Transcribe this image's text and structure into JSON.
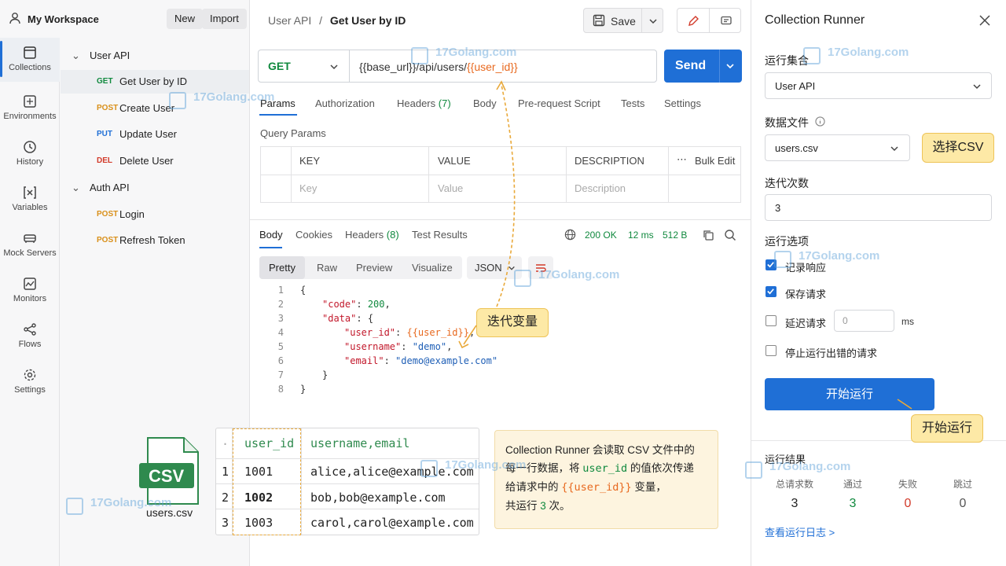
{
  "workspace": {
    "title": "My Workspace",
    "new_label": "New",
    "import_label": "Import"
  },
  "rail": [
    {
      "label": "Collections",
      "icon": "collections-icon"
    },
    {
      "label": "Environments",
      "icon": "environments-icon"
    },
    {
      "label": "History",
      "icon": "history-icon"
    },
    {
      "label": "Variables",
      "icon": "variables-icon"
    },
    {
      "label": "Mock Servers",
      "icon": "mock-servers-icon"
    },
    {
      "label": "Monitors",
      "icon": "monitors-icon"
    },
    {
      "label": "Flows",
      "icon": "flows-icon"
    },
    {
      "label": "Settings",
      "icon": "settings-icon"
    }
  ],
  "tree": {
    "folder1": "User API",
    "folder2": "Auth API",
    "requests": [
      {
        "method": "GET",
        "name": "Get User by ID"
      },
      {
        "method": "POST",
        "name": "Create User"
      },
      {
        "method": "PUT",
        "name": "Update User"
      },
      {
        "method": "DEL",
        "name": "Delete User"
      },
      {
        "method": "POST",
        "name": "Login"
      },
      {
        "method": "POST",
        "name": "Refresh Token"
      }
    ]
  },
  "breadcrumb": {
    "parent": "User API",
    "sep": "/",
    "current": "Get User by ID"
  },
  "save_label": "Save",
  "request": {
    "method": "GET",
    "url_prefix": "{{base_url}}/api/users/",
    "url_var": "{{user_id}}",
    "send_label": "Send",
    "tabs": [
      "Params",
      "Authorization",
      "Headers",
      "Body",
      "Pre-request Script",
      "Tests",
      "Settings"
    ],
    "headers_count": "(7)",
    "query_params_title": "Query Params",
    "columns": [
      "KEY",
      "VALUE",
      "DESCRIPTION"
    ],
    "bulk_edit": "Bulk Edit",
    "placeholders": [
      "Key",
      "Value",
      "Description"
    ]
  },
  "response": {
    "tabs": [
      "Body",
      "Cookies",
      "Headers",
      "Test Results"
    ],
    "headers_count": "(8)",
    "status": "200 OK",
    "time": "12 ms",
    "size": "512 B",
    "view_tabs": [
      "Pretty",
      "Raw",
      "Preview",
      "Visualize"
    ],
    "format": "JSON",
    "code_lines": [
      "1",
      "2",
      "3",
      "4",
      "5",
      "6",
      "7",
      "8"
    ],
    "code": {
      "open": "{",
      "code_key": "\"code\"",
      "code_val": "200",
      "data_key": "\"data\"",
      "data_open": "{",
      "uid_key": "\"user_id\"",
      "uid_val": "{{user_id}}",
      "uname_key": "\"username\"",
      "uname_val": "\"demo\"",
      "email_key": "\"email\"",
      "email_val": "\"demo@example.com\"",
      "inner_close": "}",
      "close": "}"
    }
  },
  "runner": {
    "title": "Collection Runner",
    "collection_label": "运行集合",
    "collection_value": "User API",
    "datafile_label": "数据文件",
    "datafile_value": "users.csv",
    "iterations_label": "迭代次数",
    "iterations_value": "3",
    "options_label": "运行选项",
    "options": [
      "记录响应",
      "保存请求",
      "延迟请求",
      "停止运行出错的请求"
    ],
    "delay_placeholder": "0",
    "delay_unit": "ms",
    "run_label": "开始运行",
    "results_label": "运行结果",
    "results_headers": [
      "总请求数",
      "通过",
      "失败",
      "跳过"
    ],
    "results_values": [
      "3",
      "3",
      "0",
      "0"
    ],
    "log_link": "查看运行日志 >",
    "colors": {
      "pass": "#10893e",
      "fail": "#d23a2a",
      "accent": "#1f6fd6"
    }
  },
  "callouts": {
    "csv": "选择CSV",
    "var": "迭代变量",
    "run": "开始运行"
  },
  "csv": {
    "badge": "CSV",
    "filename": "users.csv",
    "header_mark": "·",
    "header_uid": "user_id",
    "header_rest": "username,email",
    "rows": [
      {
        "n": "1",
        "uid": "1001",
        "rest": "alice,alice@example.com"
      },
      {
        "n": "2",
        "uid": "1002",
        "rest": "bob,bob@example.com"
      },
      {
        "n": "3",
        "uid": "1003",
        "rest": "carol,carol@example.com"
      }
    ]
  },
  "note": {
    "line1": "Collection Runner 会读取 CSV 文件中的",
    "line2a": "每一行数据，将 ",
    "line2b": "user_id",
    "line2c": " 的值依次传递",
    "line3a": "给请求中的 ",
    "line3b": "{{user_id}}",
    "line3c": " 变量，",
    "line4a": "共运行 ",
    "line4b": "3",
    "line4c": " 次。"
  },
  "watermark": "17Golang.com"
}
